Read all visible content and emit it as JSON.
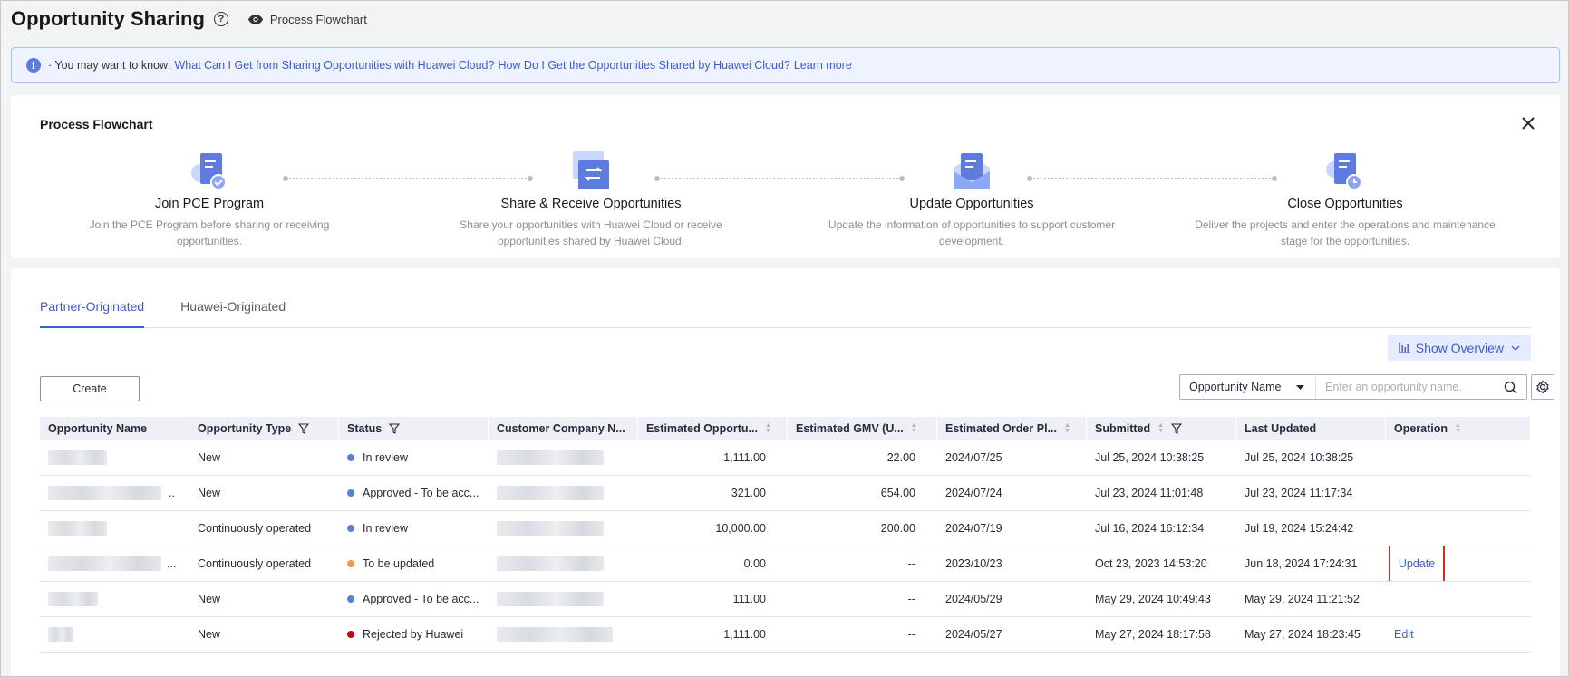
{
  "header": {
    "title": "Opportunity Sharing",
    "help_glyph": "?",
    "flowchart_link": "Process Flowchart"
  },
  "banner": {
    "icon_glyph": "i",
    "prefix": "· You may want to know:",
    "link1": "What Can I Get from Sharing Opportunities with Huawei Cloud?",
    "link2": "How Do I Get the Opportunities Shared by Huawei Cloud?",
    "link3": "Learn more"
  },
  "flowchart": {
    "title": "Process Flowchart",
    "steps": [
      {
        "name": "Join PCE Program",
        "desc": "Join the PCE Program before sharing or receiving opportunities.",
        "icon": "document-check-icon"
      },
      {
        "name": "Share & Receive Opportunities",
        "desc": "Share your opportunities with Huawei Cloud or receive opportunities shared by Huawei Cloud.",
        "icon": "exchange-icon"
      },
      {
        "name": "Update Opportunities",
        "desc": "Update the information of opportunities to support customer development.",
        "icon": "document-update-icon"
      },
      {
        "name": "Close Opportunities",
        "desc": "Deliver the projects and enter the operations and maintenance stage for the opportunities.",
        "icon": "document-clock-icon"
      }
    ]
  },
  "tabs": [
    "Partner-Originated",
    "Huawei-Originated"
  ],
  "toolbar": {
    "show_overview": "Show Overview",
    "create": "Create",
    "search_field": "Opportunity Name",
    "search_placeholder": "Enter an opportunity name."
  },
  "table": {
    "columns": [
      "Opportunity Name",
      "Opportunity Type",
      "Status",
      "Customer Company N...",
      "Estimated Opportu...",
      "Estimated GMV (U...",
      "Estimated Order Pl...",
      "Submitted",
      "Last Updated",
      "Operation"
    ],
    "rows": [
      {
        "type": "New",
        "status": "In review",
        "status_color": "#5e7ce0",
        "opp": "1,111.00",
        "gmv": "22.00",
        "order": "2024/07/25",
        "submitted": "Jul 25, 2024 10:38:25",
        "updated": "Jul 25, 2024 10:38:25",
        "op": ""
      },
      {
        "type": "New",
        "status": "Approved - To be acc...",
        "status_color": "#5e7ce0",
        "opp": "321.00",
        "gmv": "654.00",
        "order": "2024/07/24",
        "submitted": "Jul 23, 2024 11:01:48",
        "updated": "Jul 23, 2024 11:17:34",
        "op": ""
      },
      {
        "type": "Continuously operated",
        "status": "In review",
        "status_color": "#5e7ce0",
        "opp": "10,000.00",
        "gmv": "200.00",
        "order": "2024/07/19",
        "submitted": "Jul 16, 2024 16:12:34",
        "updated": "Jul 19, 2024 15:24:42",
        "op": ""
      },
      {
        "type": "Continuously operated",
        "status": "To be updated",
        "status_color": "#fa9841",
        "opp": "0.00",
        "gmv": "--",
        "order": "2023/10/23",
        "submitted": "Oct 23, 2023 14:53:20",
        "updated": "Jun 18, 2024 17:24:31",
        "op": "Update"
      },
      {
        "type": "New",
        "status": "Approved - To be acc...",
        "status_color": "#5e7ce0",
        "opp": "111.00",
        "gmv": "--",
        "order": "2024/05/29",
        "submitted": "May 29, 2024 10:49:43",
        "updated": "May 29, 2024 11:21:52",
        "op": ""
      },
      {
        "type": "New",
        "status": "Rejected by Huawei",
        "status_color": "#c7000b",
        "opp": "1,111.00",
        "gmv": "--",
        "order": "2024/05/27",
        "submitted": "May 27, 2024 18:17:58",
        "updated": "May 27, 2024 18:23:45",
        "op": "Edit"
      }
    ]
  }
}
